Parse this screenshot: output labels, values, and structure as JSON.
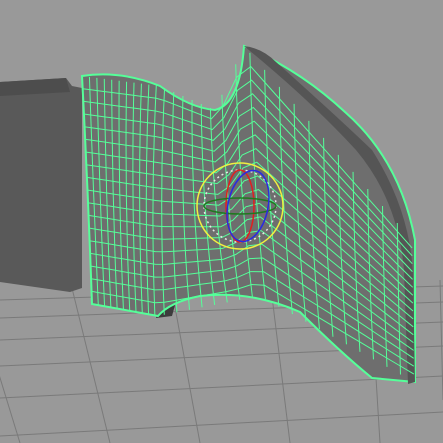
{
  "viewport": {
    "background": "#999999",
    "grid_color": "#7a7a7a",
    "wire_color": "#55ff99",
    "surface_color": "#6e6e6e",
    "dark_surface_color": "#3c3c3c",
    "background_object_color": "#595959",
    "rotate_x_color": "#e0201e",
    "rotate_y_color": "#1f7a1f",
    "rotate_z_color": "#2a2ae0",
    "rotate_view_color": "#f0f040",
    "rotate_manip_color": "#e6e6e6"
  },
  "manipulator": {
    "type": "rotate",
    "icon": "rotate-manipulator-icon"
  }
}
